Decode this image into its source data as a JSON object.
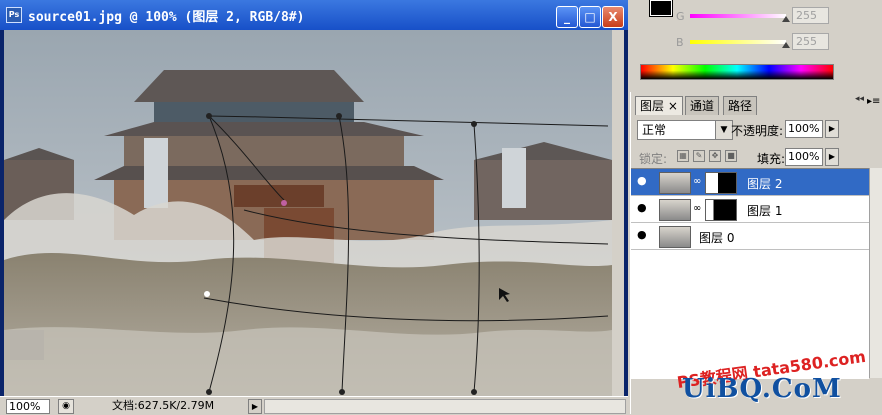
{
  "window": {
    "title": "source01.jpg @ 100% (图层 2, RGB/8#)",
    "ps_icon": "Ps",
    "min_label": "_",
    "max_label": "□",
    "close_label": "X"
  },
  "status": {
    "zoom": "100%",
    "doc_info": "文档:627.5K/2.79M",
    "arrow": "▶"
  },
  "color_panel": {
    "g_label": "G",
    "g_value": "255",
    "b_label": "B",
    "b_value": "255"
  },
  "layers_panel": {
    "tabs": [
      {
        "label": "图层 ×",
        "active": true
      },
      {
        "label": "通道",
        "active": false
      },
      {
        "label": "路径",
        "active": false
      }
    ],
    "blend_mode": "正常",
    "opacity_label": "不透明度:",
    "opacity": "100%",
    "lock_label": "锁定:",
    "fill_label": "填充:",
    "fill": "100%",
    "layers": [
      {
        "name": "图层 2",
        "selected": true,
        "has_mask": true
      },
      {
        "name": "图层 1",
        "selected": false,
        "has_mask": true
      },
      {
        "name": "图层 0",
        "selected": false,
        "has_mask": false
      }
    ]
  },
  "watermark": {
    "sub": "PS教程网",
    "main": "tata580.com",
    "logo": "UiBQ.CoM"
  },
  "icons": {
    "eye": "eye-icon",
    "chain": "chain-link-icon",
    "lock": "lock-icon"
  }
}
